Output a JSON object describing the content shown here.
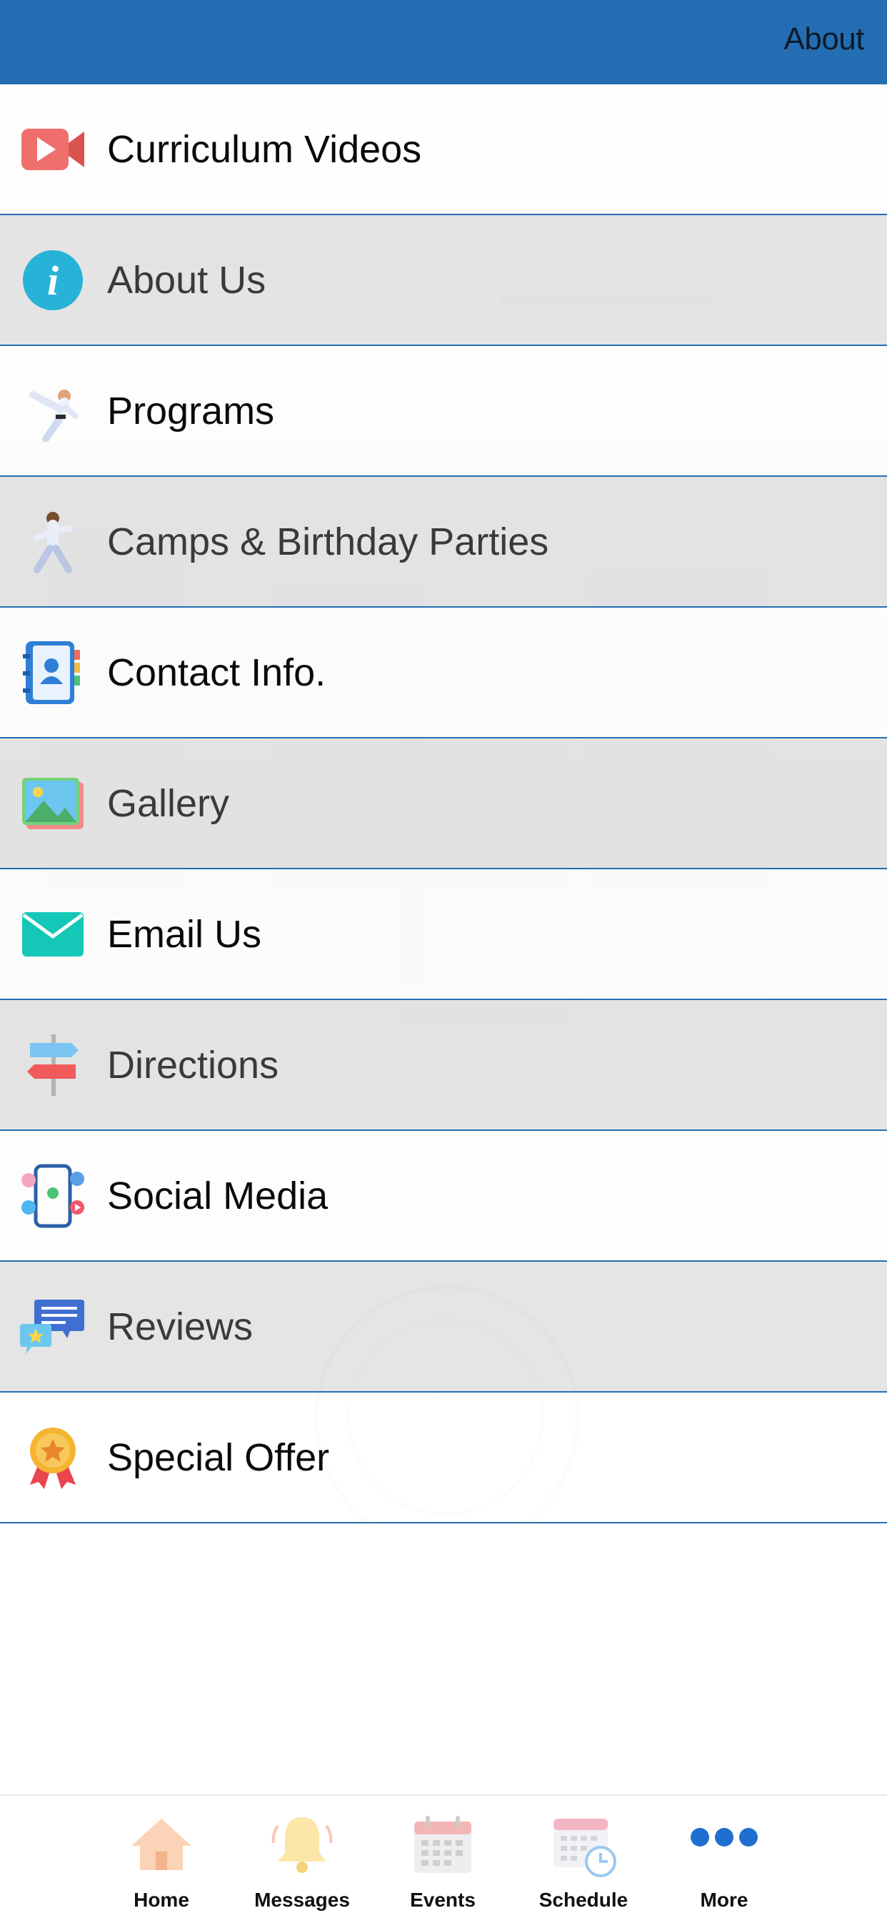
{
  "header": {
    "title": "About"
  },
  "menu": {
    "items": [
      {
        "label": "Curriculum Videos",
        "icon": "video-camera-icon"
      },
      {
        "label": "About Us",
        "icon": "info-icon"
      },
      {
        "label": "Programs",
        "icon": "martial-arts-kick-icon"
      },
      {
        "label": "Camps & Birthday Parties",
        "icon": "martial-arts-stance-icon"
      },
      {
        "label": "Contact Info.",
        "icon": "contact-book-icon"
      },
      {
        "label": "Gallery",
        "icon": "gallery-icon"
      },
      {
        "label": "Email Us",
        "icon": "envelope-icon"
      },
      {
        "label": "Directions",
        "icon": "signpost-icon"
      },
      {
        "label": "Social Media",
        "icon": "social-media-phone-icon"
      },
      {
        "label": "Reviews",
        "icon": "reviews-chat-icon"
      },
      {
        "label": "Special Offer",
        "icon": "award-medal-icon"
      }
    ]
  },
  "tabbar": {
    "tabs": [
      {
        "label": "Home",
        "icon": "home-icon"
      },
      {
        "label": "Messages",
        "icon": "bell-icon"
      },
      {
        "label": "Events",
        "icon": "calendar-icon"
      },
      {
        "label": "Schedule",
        "icon": "calendar-clock-icon"
      },
      {
        "label": "More",
        "icon": "more-dots-icon"
      }
    ]
  },
  "colors": {
    "header": "#246db3",
    "divider": "#246db3",
    "row_dark": "#e1e1e1",
    "row_light": "#ffffff"
  }
}
